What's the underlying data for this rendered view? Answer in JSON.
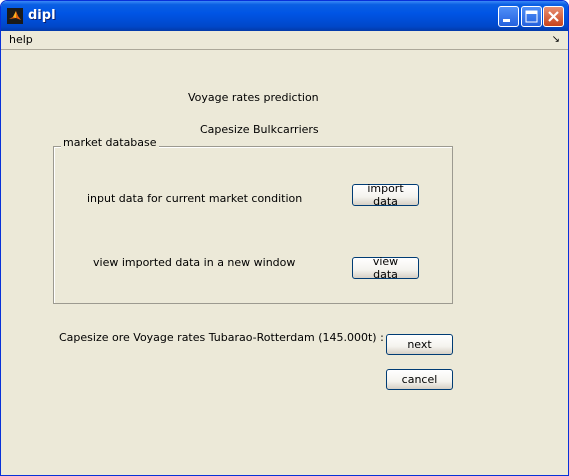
{
  "window": {
    "title": "dipl"
  },
  "menu": {
    "help": "help",
    "dock_arrow": "↘"
  },
  "heading": {
    "title": "Voyage rates prediction",
    "subtitle": "Capesize Bulkcarriers"
  },
  "market_group": {
    "title": "market database",
    "import_label": "input data for current market condition",
    "import_button": "import data",
    "view_label": "view imported data in a new window",
    "view_button": "view data"
  },
  "route": {
    "label": "Capesize ore Voyage rates Tubarao-Rotterdam (145.000t)  :",
    "next_button": "next",
    "cancel_button": "cancel"
  },
  "colors": {
    "titlebar": "#0055E5",
    "face": "#ECE9D8",
    "button_border": "#003C74"
  },
  "icons": {
    "app": "matlab-icon",
    "minimize": "minimize-icon",
    "maximize": "maximize-icon",
    "close": "close-icon"
  }
}
